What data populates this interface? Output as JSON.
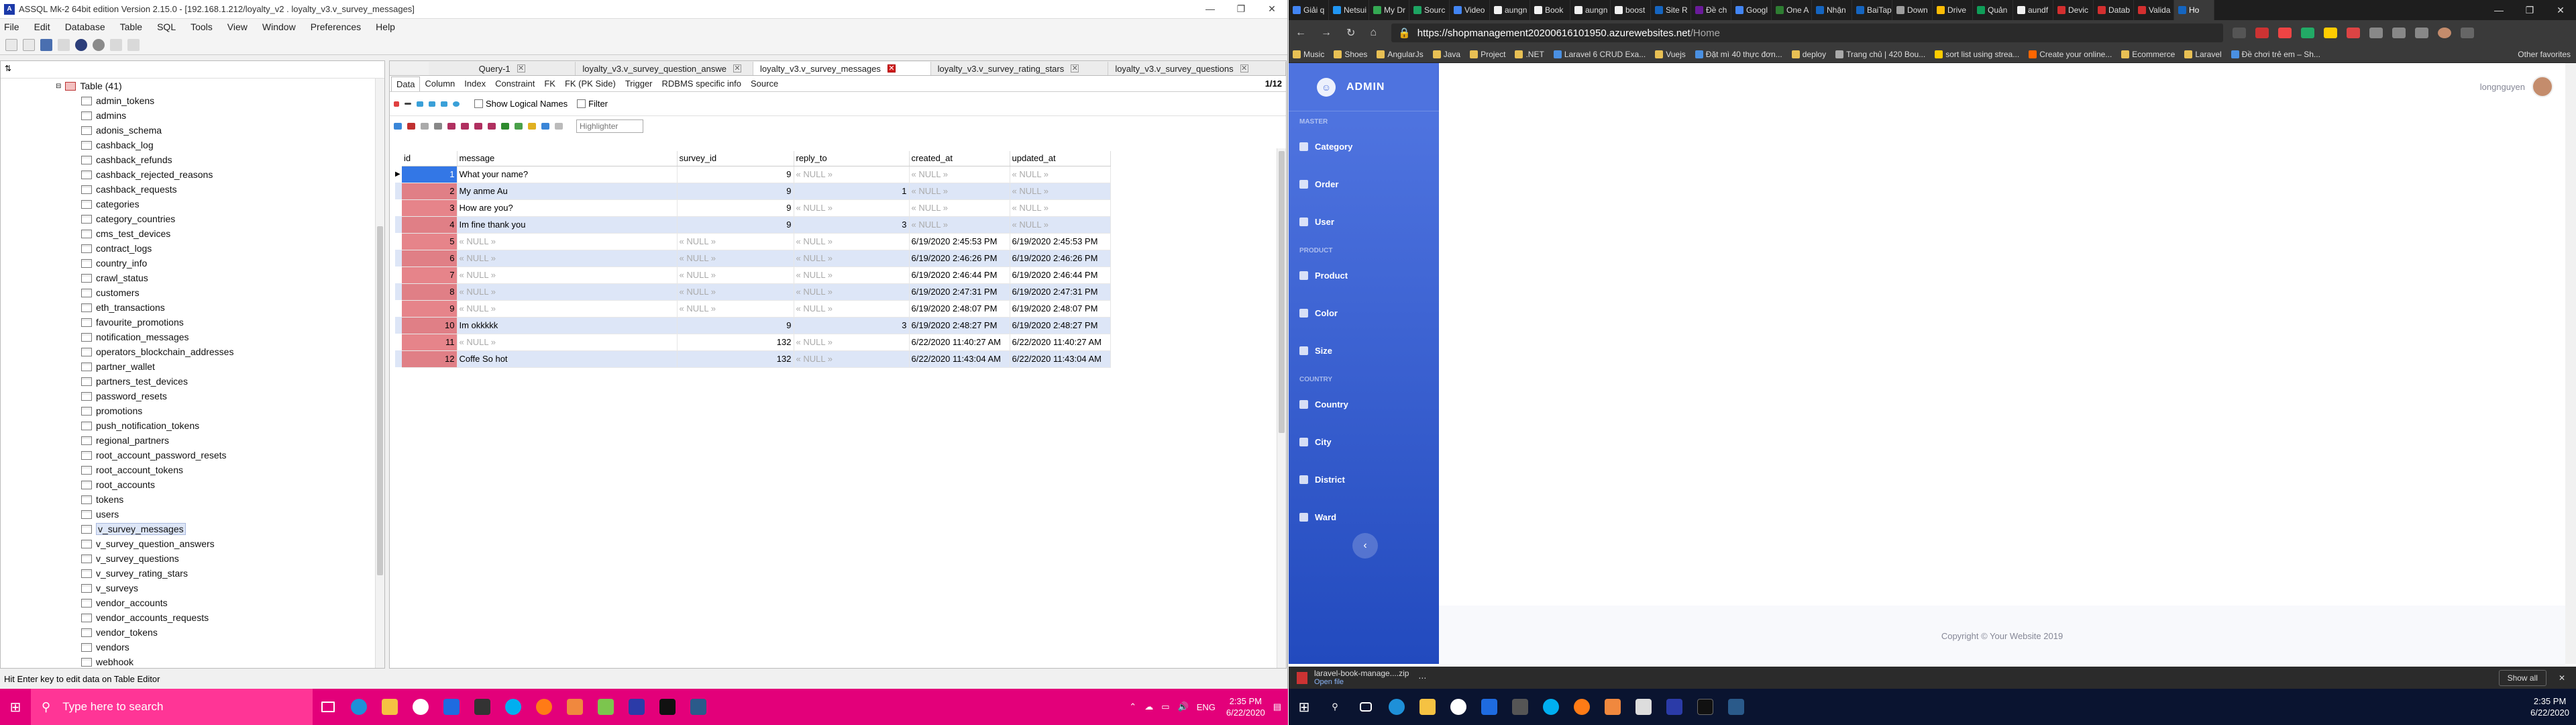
{
  "sqltool": {
    "title": "ASSQL Mk-2 64bit edition Version 2.15.0 - [192.168.1.212/loyalty_v2 . loyalty_v3.v_survey_messages]",
    "menu": [
      "File",
      "Edit",
      "Database",
      "Table",
      "SQL",
      "Tools",
      "View",
      "Window",
      "Preferences",
      "Help"
    ],
    "tree_header": "Table (41)",
    "tables": [
      "admin_tokens",
      "admins",
      "adonis_schema",
      "cashback_log",
      "cashback_refunds",
      "cashback_rejected_reasons",
      "cashback_requests",
      "categories",
      "category_countries",
      "cms_test_devices",
      "contract_logs",
      "country_info",
      "crawl_status",
      "customers",
      "eth_transactions",
      "favourite_promotions",
      "notification_messages",
      "operators_blockchain_addresses",
      "partner_wallet",
      "partners_test_devices",
      "password_resets",
      "promotions",
      "push_notification_tokens",
      "regional_partners",
      "root_account_password_resets",
      "root_account_tokens",
      "root_accounts",
      "tokens",
      "users",
      "v_survey_messages",
      "v_survey_question_answers",
      "v_survey_questions",
      "v_survey_rating_stars",
      "v_surveys",
      "vendor_accounts",
      "vendor_accounts_requests",
      "vendor_tokens",
      "vendors",
      "webhook"
    ],
    "selected_table": "v_survey_messages",
    "query_tabs": [
      "Query-1",
      "loyalty_v3.v_survey_question_answe",
      "loyalty_v3.v_survey_messages",
      "loyalty_v3.v_survey_rating_stars",
      "loyalty_v3.v_survey_questions"
    ],
    "sub_tabs": [
      "Data",
      "Column",
      "Index",
      "Constraint",
      "FK",
      "FK (PK Side)",
      "Trigger",
      "RDBMS specific info",
      "Source"
    ],
    "pager": "1/12",
    "show_logical_names": "Show Logical Names",
    "filter": "Filter",
    "highlighter_placeholder": "Highlighter",
    "columns": [
      "id",
      "message",
      "survey_id",
      "reply_to",
      "created_at",
      "updated_at"
    ],
    "rows": [
      [
        "1",
        "What your name?",
        "9",
        "« NULL »",
        "« NULL »",
        "« NULL »"
      ],
      [
        "2",
        "My anme Au",
        "9",
        "1",
        "« NULL »",
        "« NULL »"
      ],
      [
        "3",
        "How are you?",
        "9",
        "« NULL »",
        "« NULL »",
        "« NULL »"
      ],
      [
        "4",
        "Im fine thank you",
        "9",
        "3",
        "« NULL »",
        "« NULL »"
      ],
      [
        "5",
        "« NULL »",
        "« NULL »",
        "« NULL »",
        "6/19/2020 2:45:53 PM",
        "6/19/2020 2:45:53 PM"
      ],
      [
        "6",
        "« NULL »",
        "« NULL »",
        "« NULL »",
        "6/19/2020 2:46:26 PM",
        "6/19/2020 2:46:26 PM"
      ],
      [
        "7",
        "« NULL »",
        "« NULL »",
        "« NULL »",
        "6/19/2020 2:46:44 PM",
        "6/19/2020 2:46:44 PM"
      ],
      [
        "8",
        "« NULL »",
        "« NULL »",
        "« NULL »",
        "6/19/2020 2:47:31 PM",
        "6/19/2020 2:47:31 PM"
      ],
      [
        "9",
        "« NULL »",
        "« NULL »",
        "« NULL »",
        "6/19/2020 2:48:07 PM",
        "6/19/2020 2:48:07 PM"
      ],
      [
        "10",
        "Im okkkkk",
        "9",
        "3",
        "6/19/2020 2:48:27 PM",
        "6/19/2020 2:48:27 PM"
      ],
      [
        "11",
        "« NULL »",
        "132",
        "« NULL »",
        "6/22/2020 11:40:27 AM",
        "6/22/2020 11:40:27 AM"
      ],
      [
        "12",
        "Coffe So hot",
        "132",
        "« NULL »",
        "6/22/2020 11:43:04 AM",
        "6/22/2020 11:43:04 AM"
      ]
    ],
    "status": "Hit Enter key to edit data on Table Editor"
  },
  "browser": {
    "tabs": [
      "Giải q",
      "Netsui",
      "My Dr",
      "Sourc",
      "Video",
      "aungn",
      "Book",
      "aungn",
      "boost",
      "Site R",
      "Đề ch",
      "Googl",
      "One A",
      "Nhận",
      "BaiTap",
      "Down",
      "Drive",
      "Quản",
      "aundf",
      "Devic",
      "Datab",
      "Valida",
      "Ho"
    ],
    "tab_colors": [
      "#4285f4",
      "#2196f3",
      "#34a853",
      "#1da462",
      "#4285f4",
      "#f1f1f1",
      "#f1f1f1",
      "#f1f1f1",
      "#f1f1f1",
      "#1565c0",
      "#6a1b9a",
      "#4285f4",
      "#2e7d32",
      "#1565c0",
      "#1565c0",
      "#9e9e9e",
      "#fbbc05",
      "#0f9d58",
      "#f1f1f1",
      "#d32f2f",
      "#d32f2f",
      "#d32f2f",
      "#1565c0"
    ],
    "url_host": "https://shopmanagement20200616101950.azurewebsites.net",
    "url_path": "/Home",
    "bookmarks": [
      "Music",
      "Shoes",
      "AngularJs",
      "Java",
      "Project",
      ".NET",
      "Laravel 6 CRUD Exa...",
      "Vuejs",
      "Đặt mì 40 thực đơn...",
      "deploy",
      "Trang chủ | 420 Bou...",
      "sort list using strea...",
      "Create your online...",
      "Ecommerce",
      "Laravel",
      "Đề chơi trẻ em – Sh..."
    ],
    "bookmark_other": "Other favorites",
    "download_file": "laravel-book-manage....zip",
    "download_sub": "Open file",
    "show_all": "Show all"
  },
  "admin": {
    "brand": "ADMIN",
    "sections": [
      {
        "heading": "MASTER",
        "items": [
          "Category",
          "Order",
          "User"
        ]
      },
      {
        "heading": "PRODUCT",
        "items": [
          "Product",
          "Color",
          "Size"
        ]
      },
      {
        "heading": "COUNTRY",
        "items": [
          "Country",
          "City",
          "District",
          "Ward"
        ]
      }
    ],
    "username": "longnguyen",
    "footer": "Copyright © Your Website 2019",
    "toggle_icon": "‹"
  },
  "taskbar": {
    "search_placeholder": "Type here to search",
    "lang": "ENG",
    "time": "2:35 PM",
    "date": "6/22/2020",
    "time2": "2:35 PM",
    "date2": "6/22/2020"
  }
}
